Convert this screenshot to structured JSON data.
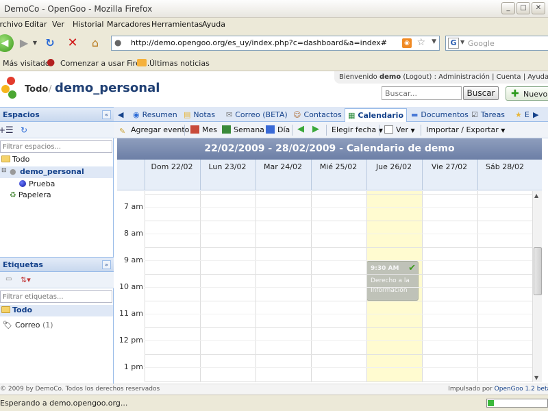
{
  "window": {
    "title": "DemoCo - OpenGoo - Mozilla Firefox"
  },
  "menu": [
    "Archivo",
    "Editar",
    "Ver",
    "Historial",
    "Marcadores",
    "Herramientas",
    "Ayuda"
  ],
  "browser": {
    "url": "http://demo.opengoo.org/es_uy/index.php?c=dashboard&a=index#",
    "search_placeholder": "Google"
  },
  "bookmarks": [
    "Más visitados",
    "Comenzar a usar Firef...",
    "Últimas noticias"
  ],
  "app": {
    "crumb_root": "Todo",
    "crumb_sep": "/",
    "workspace": "demo_personal",
    "welcome_prefix": "Bienvenido",
    "user": "demo",
    "logout": "(Logout)",
    "admin": "Administración",
    "account": "Cuenta",
    "help": "Ayuda",
    "search_placeholder": "Buscar...",
    "search_button": "Buscar",
    "new_button": "Nuevo"
  },
  "sidebar": {
    "spaces_title": "Espacios",
    "spaces_filter_placeholder": "Filtrar espacios...",
    "spaces_tree": [
      {
        "label": "Todo",
        "type": "folder"
      },
      {
        "label": "demo_personal",
        "type": "workspace"
      },
      {
        "label": "Prueba",
        "type": "ball"
      },
      {
        "label": "Papelera",
        "type": "trash"
      }
    ],
    "tags_title": "Etiquetas",
    "tags_filter_placeholder": "Filtrar etiquetas...",
    "tags_all": "Todo",
    "tags": [
      {
        "label": "Correo",
        "count": "(1)"
      }
    ]
  },
  "tabs": [
    {
      "label": "Resumen",
      "icon": "globe-icon"
    },
    {
      "label": "Notas",
      "icon": "note-icon"
    },
    {
      "label": "Correo (BETA)",
      "icon": "mail-icon"
    },
    {
      "label": "Contactos",
      "icon": "contact-icon"
    },
    {
      "label": "Calendario",
      "icon": "calendar-icon",
      "active": true
    },
    {
      "label": "Documentos",
      "icon": "docs-icon"
    },
    {
      "label": "Tareas",
      "icon": "tasks-icon"
    },
    {
      "label": "E",
      "icon": "star-icon"
    }
  ],
  "calendar_toolbar": {
    "add_event": "Agregar evento",
    "month": "Mes",
    "week": "Semana",
    "day": "Día",
    "choose_date": "Elegir fecha",
    "view": "Ver",
    "import_export": "Importar / Exportar"
  },
  "calendar": {
    "header": "22/02/2009 - 28/02/2009 - Calendario de demo",
    "days": [
      "Dom 22/02",
      "Lun 23/02",
      "Mar 24/02",
      "Mié 25/02",
      "Jue 26/02",
      "Vie 27/02",
      "Sáb 28/02"
    ],
    "hours": [
      "7 am",
      "8 am",
      "9 am",
      "10 am",
      "11 am",
      "12 pm",
      "1 pm"
    ],
    "today": "Jue 26/02",
    "event": {
      "time": "9:30 AM",
      "title": "Derecho a la Información",
      "day": "Jue 26/02",
      "start_hour": 9.5,
      "end_hour": 11.0
    }
  },
  "footer": {
    "copyright": "© 2009 by DemoCo. Todos los derechos reservados",
    "powered_prefix": "Impulsado por",
    "powered_link": "OpenGoo 1.2 beta"
  },
  "status": {
    "message": "Esperando a demo.opengoo.org...",
    "progress": 0.1
  }
}
